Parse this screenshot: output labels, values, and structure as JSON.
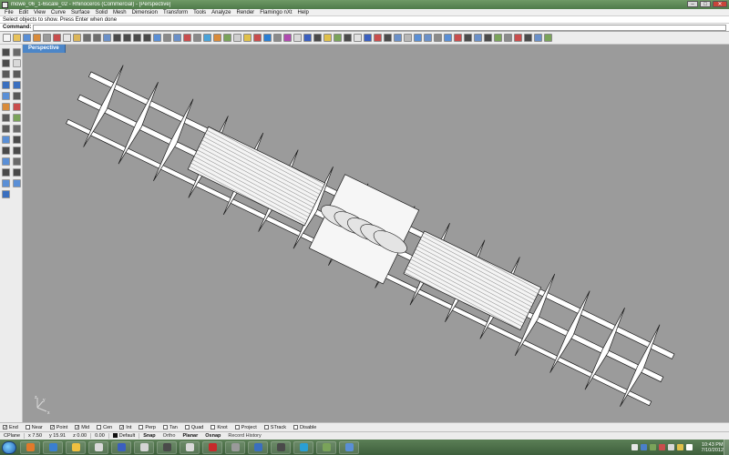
{
  "window": {
    "title": "mowe_06_1-6scale_02 - Rhinoceros (Commercial) - [Perspective]",
    "minimize": "–",
    "maximize": "□",
    "close": "✕"
  },
  "menu": [
    "File",
    "Edit",
    "View",
    "Curve",
    "Surface",
    "Solid",
    "Mesh",
    "Dimension",
    "Transform",
    "Tools",
    "Analyze",
    "Render",
    "Flamingo nXt",
    "Help"
  ],
  "command": {
    "history": "Select objects to show. Press Enter when done",
    "prompt_label": "Command:",
    "value": ""
  },
  "viewport": {
    "tab": "Perspective",
    "axis_x": "x",
    "axis_y": "y",
    "axis_z": "z"
  },
  "osnap": [
    {
      "label": "End",
      "checked": true
    },
    {
      "label": "Near",
      "checked": false
    },
    {
      "label": "Point",
      "checked": true
    },
    {
      "label": "Mid",
      "checked": true
    },
    {
      "label": "Cen",
      "checked": false
    },
    {
      "label": "Int",
      "checked": true
    },
    {
      "label": "Perp",
      "checked": false
    },
    {
      "label": "Tan",
      "checked": false
    },
    {
      "label": "Quad",
      "checked": false
    },
    {
      "label": "Knot",
      "checked": false
    },
    {
      "label": "Project",
      "checked": false
    },
    {
      "label": "STrack",
      "checked": false
    },
    {
      "label": "Disable",
      "checked": false
    }
  ],
  "status": {
    "cplane": "CPlane",
    "x": "x 7.50",
    "y": "y 15.91",
    "z": "z 0.00",
    "extra": "0.00",
    "layer": "Default",
    "snap": "Snap",
    "ortho": "Ortho",
    "planar": "Planar",
    "osnap": "Osnap",
    "record_history": "Record History"
  },
  "taskbar": {
    "time": "10:43 PM",
    "date": "7/10/2012"
  },
  "colors": {
    "viewport_bg": "#9b9b9b",
    "tab_active": "#4c86c8",
    "model_fill": "#ffffff",
    "model_edge": "#1a1a1a"
  }
}
